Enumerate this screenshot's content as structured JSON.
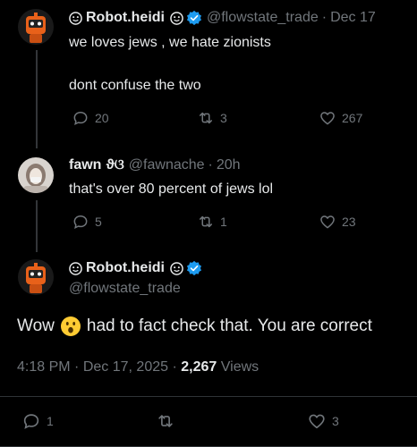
{
  "reply_parent": {
    "name": "Robot.heidi",
    "handle": "@flowstate_trade",
    "separator": "·",
    "time": "Dec 17",
    "text_line1": "we loves jews , we hate zionists",
    "text_line2": "dont confuse the two",
    "replies": "20",
    "reposts": "3",
    "likes": "267"
  },
  "reply_child": {
    "name": "fawn",
    "name_suffix": "ϑଓ",
    "handle": "@fawnache",
    "separator": "·",
    "time": "20h",
    "text": "that's over 80 percent of jews lol",
    "replies": "5",
    "reposts": "1",
    "likes": "23"
  },
  "main_tweet": {
    "name": "Robot.heidi",
    "handle": "@flowstate_trade",
    "text_before": "Wow",
    "emoji": "😮",
    "text_after": "had to fact check that. You are correct",
    "time": "4:18 PM",
    "date": "Dec 17, 2025",
    "views_count": "2,267",
    "views_label": "Views",
    "replies": "1",
    "likes": "3"
  },
  "icons": {
    "name_badge": "smiley-circle-icon",
    "verified": "verified-badge-icon",
    "reply": "reply-icon",
    "repost": "repost-icon",
    "like": "heart-icon"
  },
  "colors": {
    "background": "#000000",
    "text": "#e7e9ea",
    "muted": "#71767b",
    "verified": "#1d9bf0",
    "avatar_robot": "#e8611a"
  }
}
